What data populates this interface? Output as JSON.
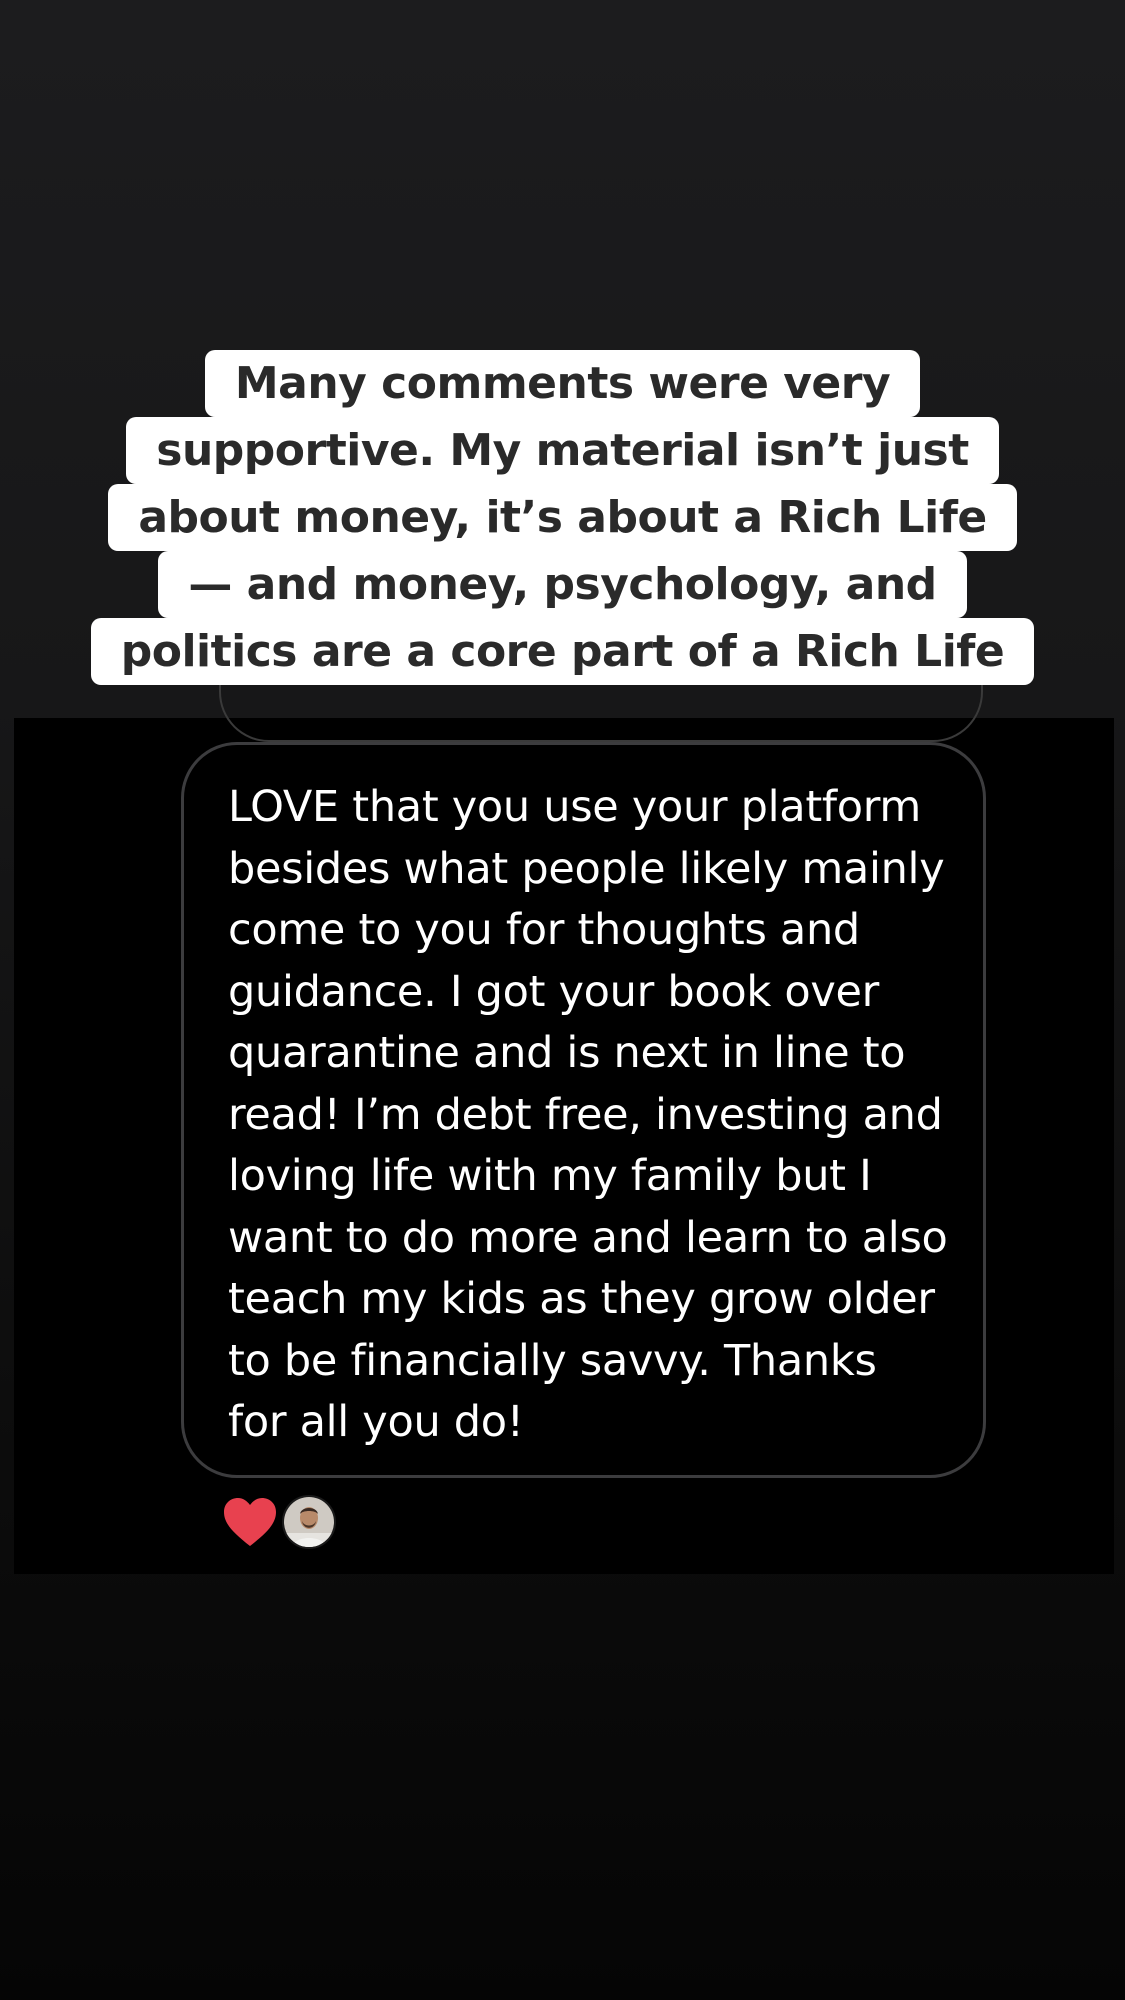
{
  "caption": {
    "lines": [
      "Many comments were very",
      "supportive. My material isn’t just",
      "about money, it’s about a Rich Life",
      "— and money, psychology, and",
      "politics are a core part of a Rich Life"
    ]
  },
  "message": {
    "lines": [
      "LOVE that you use your platform",
      "besides what people likely mainly",
      "come to you for thoughts and",
      "guidance. I got your book over",
      "quarantine and is next in line to",
      "read! I’m debt free, investing and",
      "loving life with my family but I",
      "want to do more and learn to also",
      "teach my kids as they grow older",
      "to be financially savvy. Thanks",
      "for all you do!"
    ]
  },
  "reactions": {
    "items": [
      {
        "icon": "heart-icon",
        "color": "#e8414f"
      },
      {
        "icon": "avatar"
      }
    ]
  },
  "colors": {
    "caption_bg": "#ffffff",
    "caption_text": "#2a2a2a",
    "panel_bg": "#000000",
    "bubble_border": "#3c3c3e",
    "message_text": "#ffffff",
    "heart": "#e8414f"
  }
}
